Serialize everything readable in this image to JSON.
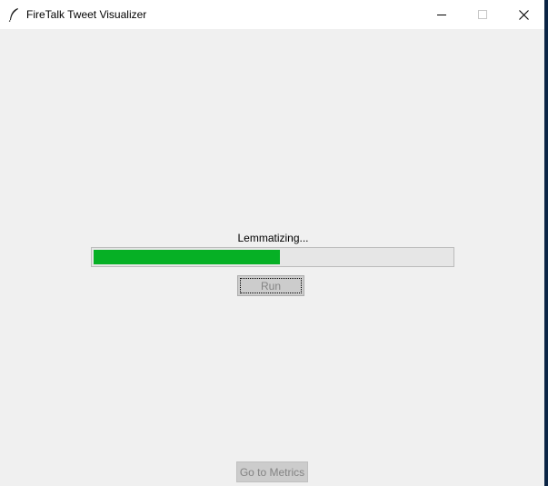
{
  "window": {
    "title": "FireTalk Tweet Visualizer",
    "app_icon": "feather-icon",
    "controls": {
      "minimize_icon": "minimize-icon",
      "maximize_icon": "maximize-icon",
      "close_icon": "close-icon"
    }
  },
  "main": {
    "status_label": "Lemmatizing...",
    "progress_fraction": 0.52,
    "progress_color": "#06b025",
    "run_button_label": "Run",
    "run_button_enabled": false,
    "metrics_button_label": "Go to Metrics",
    "metrics_button_enabled": false
  }
}
